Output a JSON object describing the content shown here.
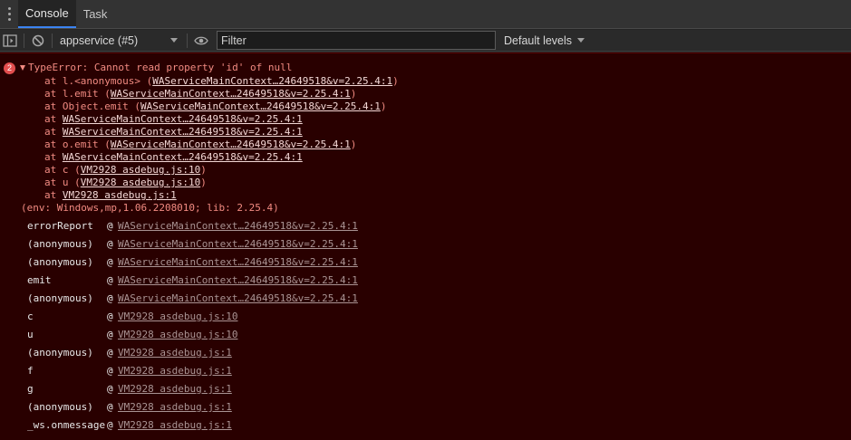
{
  "tabs": [
    {
      "label": "Console",
      "active": true
    },
    {
      "label": "Task",
      "active": false
    }
  ],
  "toolbar": {
    "context": "appservice (#5)",
    "filter_placeholder": "Filter",
    "levels": "Default levels"
  },
  "error": {
    "count": "2",
    "message": "TypeError: Cannot read property 'id' of null",
    "frames": [
      {
        "prefix": "at l.<anonymous> (",
        "link": "WAServiceMainContext…24649518&v=2.25.4:1",
        "suffix": ")"
      },
      {
        "prefix": "at l.emit (",
        "link": "WAServiceMainContext…24649518&v=2.25.4:1",
        "suffix": ")"
      },
      {
        "prefix": "at Object.emit (",
        "link": "WAServiceMainContext…24649518&v=2.25.4:1",
        "suffix": ")"
      },
      {
        "prefix": "at ",
        "link": "WAServiceMainContext…24649518&v=2.25.4:1",
        "suffix": ""
      },
      {
        "prefix": "at ",
        "link": "WAServiceMainContext…24649518&v=2.25.4:1",
        "suffix": ""
      },
      {
        "prefix": "at o.emit (",
        "link": "WAServiceMainContext…24649518&v=2.25.4:1",
        "suffix": ")"
      },
      {
        "prefix": "at ",
        "link": "WAServiceMainContext…24649518&v=2.25.4:1",
        "suffix": ""
      },
      {
        "prefix": "at c (",
        "link": "VM2928 asdebug.js:10",
        "suffix": ")"
      },
      {
        "prefix": "at u (",
        "link": "VM2928 asdebug.js:10",
        "suffix": ")"
      },
      {
        "prefix": "at ",
        "link": "VM2928 asdebug.js:1",
        "suffix": ""
      }
    ],
    "env": "(env: Windows,mp,1.06.2208010; lib: 2.25.4)"
  },
  "stack": [
    {
      "fn": "errorReport",
      "src": "WAServiceMainContext…24649518&v=2.25.4:1"
    },
    {
      "fn": "(anonymous)",
      "src": "WAServiceMainContext…24649518&v=2.25.4:1"
    },
    {
      "fn": "(anonymous)",
      "src": "WAServiceMainContext…24649518&v=2.25.4:1"
    },
    {
      "fn": "emit",
      "src": "WAServiceMainContext…24649518&v=2.25.4:1"
    },
    {
      "fn": "(anonymous)",
      "src": "WAServiceMainContext…24649518&v=2.25.4:1"
    },
    {
      "fn": "c",
      "src": "VM2928 asdebug.js:10"
    },
    {
      "fn": "u",
      "src": "VM2928 asdebug.js:10"
    },
    {
      "fn": "(anonymous)",
      "src": "VM2928 asdebug.js:1"
    },
    {
      "fn": "f",
      "src": "VM2928 asdebug.js:1"
    },
    {
      "fn": "g",
      "src": "VM2928 asdebug.js:1"
    },
    {
      "fn": "(anonymous)",
      "src": "VM2928 asdebug.js:1"
    },
    {
      "fn": "_ws.onmessage",
      "src": "VM2928 asdebug.js:1"
    }
  ],
  "stack_at": "@",
  "colors": {
    "error_bg": "#290000",
    "error_text": "#f28b82",
    "tab_accent": "#3b84f2"
  }
}
